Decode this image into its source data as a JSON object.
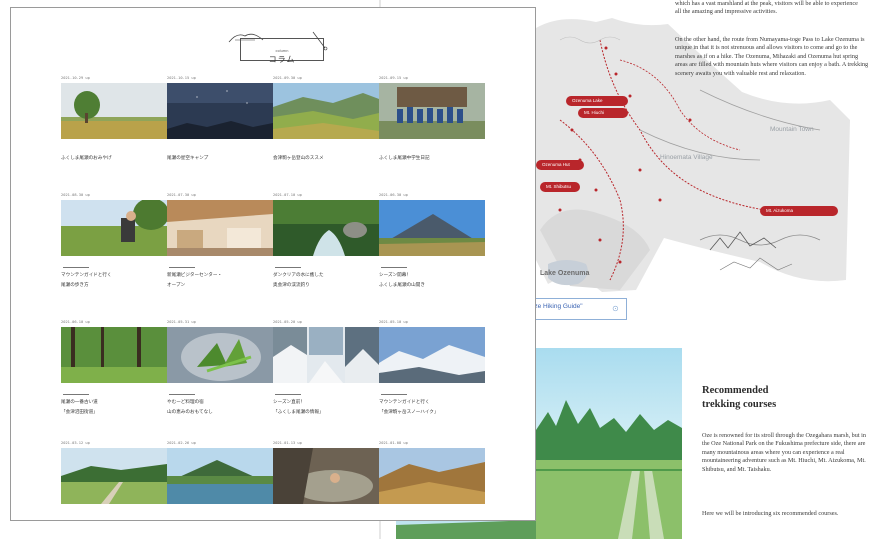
{
  "colors": {
    "frame_border": "#9a9a9a",
    "accent_red": "#b9262b",
    "link_blue": "#3a63b3"
  },
  "column_page": {
    "header": {
      "subtitle": "column",
      "title": "コラム",
      "icons": [
        "mountain-logo-icon",
        "pencil-icon"
      ]
    },
    "articles": [
      {
        "date": "2021.10.29 up",
        "title": [
          "ふくしま尾瀬のおみやげ"
        ],
        "thumbnail": "lone tree in meadow"
      },
      {
        "date": "2021.10.15 up",
        "title": [
          "尾瀬の星空キャンプ"
        ],
        "thumbnail": "night sky"
      },
      {
        "date": "2021.09.30 up",
        "title": [
          "会津駒ヶ岳登山のススメ"
        ],
        "thumbnail": "mountain slopes"
      },
      {
        "date": "2021.09.15 up",
        "title": [
          "ふくしま尾瀬中学生日記"
        ],
        "thumbnail": "group photo in front of lodge"
      },
      {
        "date": "2021.08.30 up",
        "title": [
          "マウンテンガイドと行く",
          "尾瀬の歩き方"
        ],
        "thumbnail": "hiker with backpack"
      },
      {
        "date": "2021.07.30 up",
        "title": [
          "新尾瀬ビジターセンター・",
          "オープン"
        ],
        "thumbnail": "visitor center interior"
      },
      {
        "date": "2021.07.10 up",
        "title": [
          "ダンクリアの水に癒した",
          "奥会津の渓流釣り"
        ],
        "thumbnail": "forest stream"
      },
      {
        "date": "2021.06.30 up",
        "title": [
          "シーズン開幕！",
          "ふくしま尾瀬の山開き"
        ],
        "thumbnail": "mountain under blue sky"
      },
      {
        "date": "2021.06.10 up",
        "title": [
          "尾瀬の一番古い道",
          "「会津沼田街道」"
        ],
        "thumbnail": "green forest path"
      },
      {
        "date": "2021.05.31 up",
        "title": [
          "やむーど料理の宿",
          "山の恵みのおもてなし"
        ],
        "thumbnail": "wild plants on plate"
      },
      {
        "date": "2021.05.20 up",
        "title": [
          "シーズン直前！",
          "「ふくしま尾瀬の情報」"
        ],
        "thumbnail": "snowy mountains collage"
      },
      {
        "date": "2021.05.10 up",
        "title": [
          "マウンテンガイドと行く",
          "「会津駒ヶ岳スノーハイク」"
        ],
        "thumbnail": "snow covered ridges"
      },
      {
        "date": "2021.03.12 up",
        "title": [],
        "thumbnail": "wetland boardwalk"
      },
      {
        "date": "2021.02.26 up",
        "title": [],
        "thumbnail": "mountain across lake"
      },
      {
        "date": "2021.01.13 up",
        "title": [],
        "thumbnail": "person bathing in hot spring"
      },
      {
        "date": "2021.01.08 up",
        "title": [],
        "thumbnail": "autumn mountain ridge"
      }
    ]
  },
  "brochure": {
    "paragraph_top": "which has a vast marshland at the peak, visitors will be able to experience all the amazing and impressive activities.",
    "paragraph_mid": "On the other hand, the route from Numayama-toge Pass to Lake Ozenuma is unique in that it is not strenuous and allows visitors to come and go to the marshes as if on a hike. The Ozenuma, Mihazaki and Ozenuma hut spring areas are filled with mountain huts where visitors can enjoy a bath. A trekking scenery awaits you with valuable rest and relaxation.",
    "map_labels": [
      "Mountain Town",
      "Hinoemata Village"
    ],
    "map_pills": [
      "Ozenuma Lake",
      "Mt. Hiuchi",
      "Ozenuma Hut",
      "Mt. Aizukoma",
      "Mt. Shibutsu"
    ],
    "map_lake_label": "Lake Ozenuma",
    "guide_link": "\"Oze Hiking Guide\"",
    "recommended_heading": [
      "Recommended",
      "trekking courses"
    ],
    "paragraph_recommended": "Oze is renowned for its stroll through the Ozegahara marsh, but in the Oze National Park on the Fukushima prefecture side, there are many mountainous areas where you can experience a real mountaineering adventure such as Mt. Hiuchi, Mt. Aizukoma, Mt. Shibutsu, and Mt. Taishaku.",
    "paragraph_intro": "Here we will be introducing six recommended courses."
  }
}
